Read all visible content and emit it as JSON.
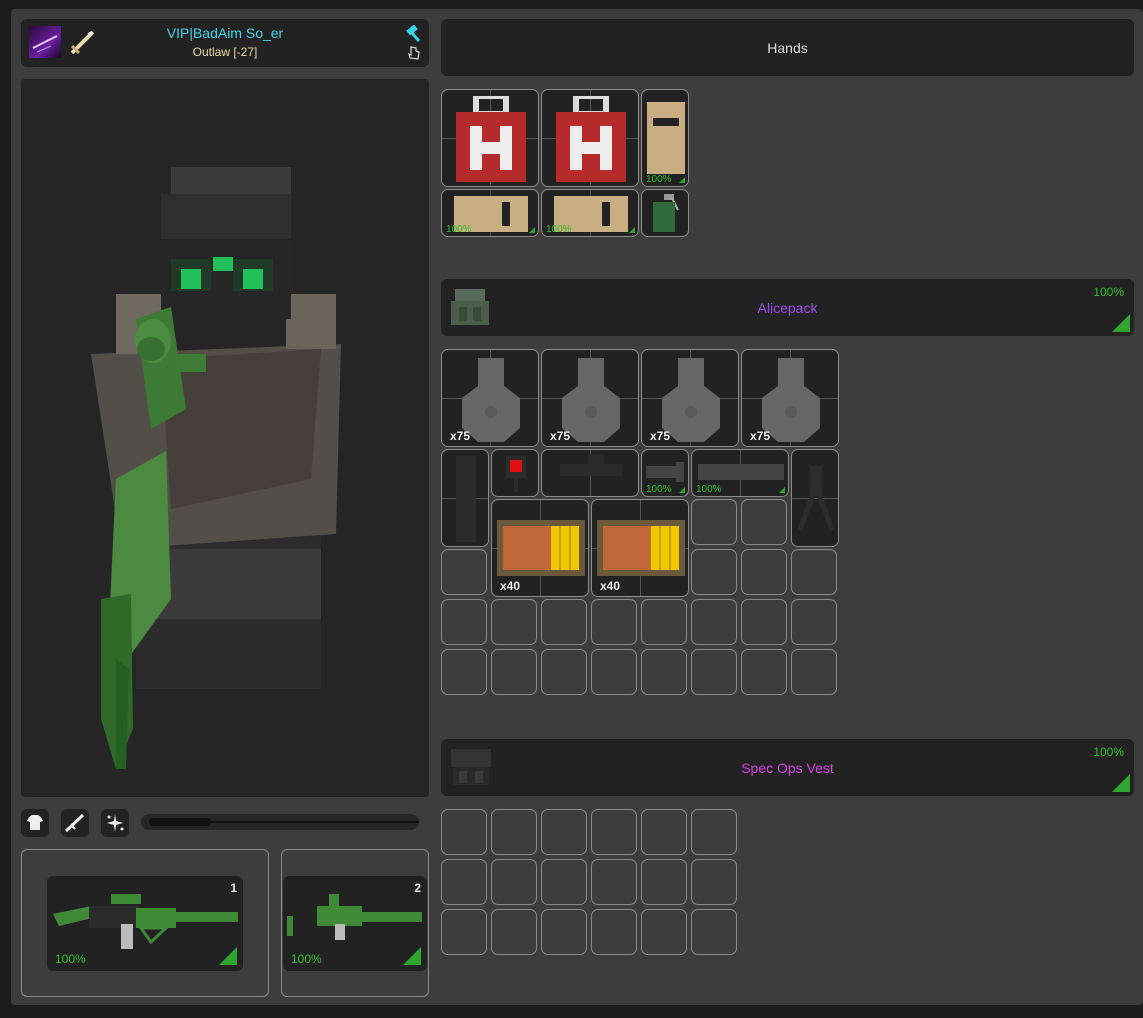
{
  "player": {
    "name": "VIP|BadAim So_er",
    "faction": "Outlaw [-27]",
    "name_color": "#3fd6e6",
    "faction_color": "#e8d9a0"
  },
  "hands": {
    "title": "Hands"
  },
  "hands_items": [
    {
      "name": "Medkit"
    },
    {
      "name": "Medkit"
    },
    {
      "name": "Bandage",
      "durability": "100%"
    },
    {
      "name": "Cloth",
      "durability": "100%"
    },
    {
      "name": "Cloth",
      "durability": "100%"
    },
    {
      "name": "Grenade"
    }
  ],
  "backpack": {
    "name": "Alicepack",
    "name_color": "#9b4fe8",
    "durability": "100%"
  },
  "backpack_items": [
    {
      "name": "Ammo Box",
      "qty": "x75"
    },
    {
      "name": "Ammo Box",
      "qty": "x75"
    },
    {
      "name": "Ammo Box",
      "qty": "x75"
    },
    {
      "name": "Ammo Box",
      "qty": "x75"
    },
    {
      "name": "Suppressor"
    },
    {
      "name": "Red Dot"
    },
    {
      "name": "Scope"
    },
    {
      "name": "Grip",
      "durability": "100%"
    },
    {
      "name": "Barrel",
      "durability": "100%"
    },
    {
      "name": "Bipod"
    },
    {
      "name": "Magazine",
      "qty": "x40"
    },
    {
      "name": "Magazine",
      "qty": "x40"
    }
  ],
  "vest": {
    "name": "Spec Ops Vest",
    "name_color": "#d43fe0",
    "durability": "100%"
  },
  "loadout_buttons": [
    "shirt-icon",
    "weapon-icon",
    "sparkle-icon"
  ],
  "weapons": [
    {
      "slot": "1",
      "durability": "100%"
    },
    {
      "slot": "2",
      "durability": "100%"
    }
  ],
  "slider": {
    "fill": 0.25
  }
}
